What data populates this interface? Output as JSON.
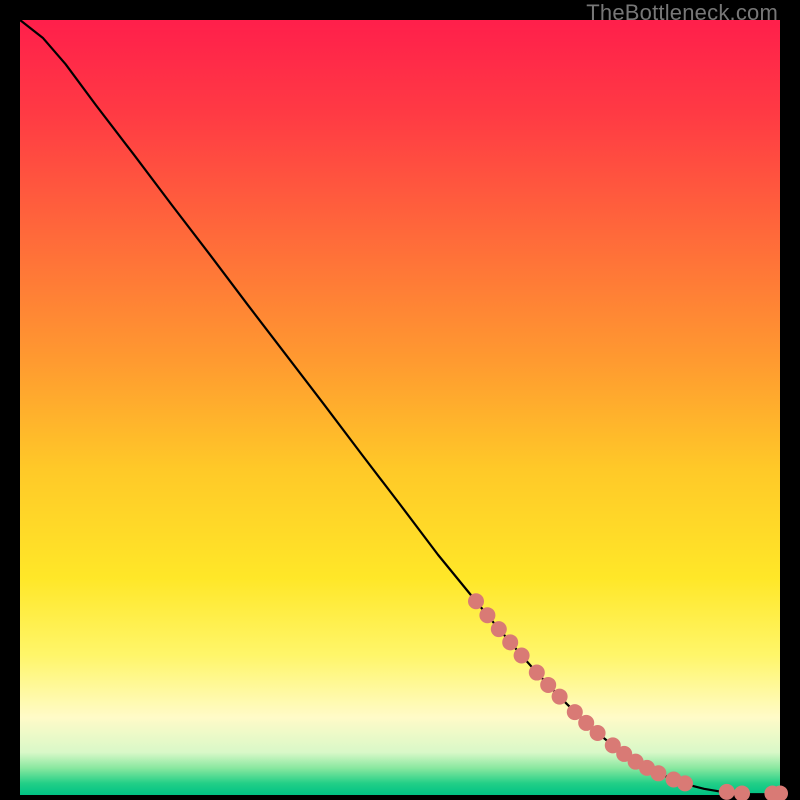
{
  "watermark": "TheBottleneck.com",
  "gradient": {
    "stops": [
      {
        "offset": 0.0,
        "color": "#ff1f4b"
      },
      {
        "offset": 0.12,
        "color": "#ff3a44"
      },
      {
        "offset": 0.28,
        "color": "#ff6a3a"
      },
      {
        "offset": 0.44,
        "color": "#ff9a30"
      },
      {
        "offset": 0.58,
        "color": "#ffc928"
      },
      {
        "offset": 0.72,
        "color": "#ffe728"
      },
      {
        "offset": 0.82,
        "color": "#fff66a"
      },
      {
        "offset": 0.9,
        "color": "#fffbc8"
      },
      {
        "offset": 0.945,
        "color": "#d9f8c8"
      },
      {
        "offset": 0.965,
        "color": "#8ae8a0"
      },
      {
        "offset": 0.985,
        "color": "#22cf87"
      },
      {
        "offset": 1.0,
        "color": "#00c184"
      }
    ]
  },
  "chart_data": {
    "type": "line",
    "title": "",
    "xlabel": "",
    "ylabel": "",
    "xlim": [
      0,
      100
    ],
    "ylim": [
      0,
      100
    ],
    "series": [
      {
        "name": "curve",
        "x": [
          0.0,
          3.0,
          6.0,
          10.0,
          15.0,
          20.0,
          25.0,
          30.0,
          35.0,
          40.0,
          45.0,
          50.0,
          55.0,
          60.0,
          62.0,
          64.0,
          66.0,
          68.0,
          70.0,
          72.0,
          74.0,
          76.0,
          78.0,
          80.0,
          82.0,
          84.0,
          86.0,
          88.0,
          90.0,
          93.0,
          96.0,
          98.0,
          100.0
        ],
        "y": [
          100.0,
          97.7,
          94.3,
          89.0,
          82.6,
          76.1,
          69.7,
          63.2,
          56.8,
          50.4,
          43.9,
          37.5,
          31.0,
          25.0,
          22.6,
          20.3,
          18.0,
          15.8,
          13.7,
          11.7,
          9.8,
          8.0,
          6.4,
          5.0,
          3.8,
          2.8,
          2.0,
          1.3,
          0.8,
          0.3,
          0.1,
          0.1,
          0.2
        ]
      }
    ],
    "markers": [
      {
        "x": 60.0,
        "y": 25.0
      },
      {
        "x": 61.5,
        "y": 23.2
      },
      {
        "x": 63.0,
        "y": 21.4
      },
      {
        "x": 64.5,
        "y": 19.7
      },
      {
        "x": 66.0,
        "y": 18.0
      },
      {
        "x": 68.0,
        "y": 15.8
      },
      {
        "x": 69.5,
        "y": 14.2
      },
      {
        "x": 71.0,
        "y": 12.7
      },
      {
        "x": 73.0,
        "y": 10.7
      },
      {
        "x": 74.5,
        "y": 9.3
      },
      {
        "x": 76.0,
        "y": 8.0
      },
      {
        "x": 78.0,
        "y": 6.4
      },
      {
        "x": 79.5,
        "y": 5.3
      },
      {
        "x": 81.0,
        "y": 4.3
      },
      {
        "x": 82.5,
        "y": 3.5
      },
      {
        "x": 84.0,
        "y": 2.8
      },
      {
        "x": 86.0,
        "y": 2.0
      },
      {
        "x": 87.5,
        "y": 1.5
      },
      {
        "x": 93.0,
        "y": 0.4
      },
      {
        "x": 95.0,
        "y": 0.2
      },
      {
        "x": 99.0,
        "y": 0.2
      },
      {
        "x": 100.0,
        "y": 0.2
      }
    ],
    "marker_color": "#d97a75",
    "marker_radius": 8
  }
}
